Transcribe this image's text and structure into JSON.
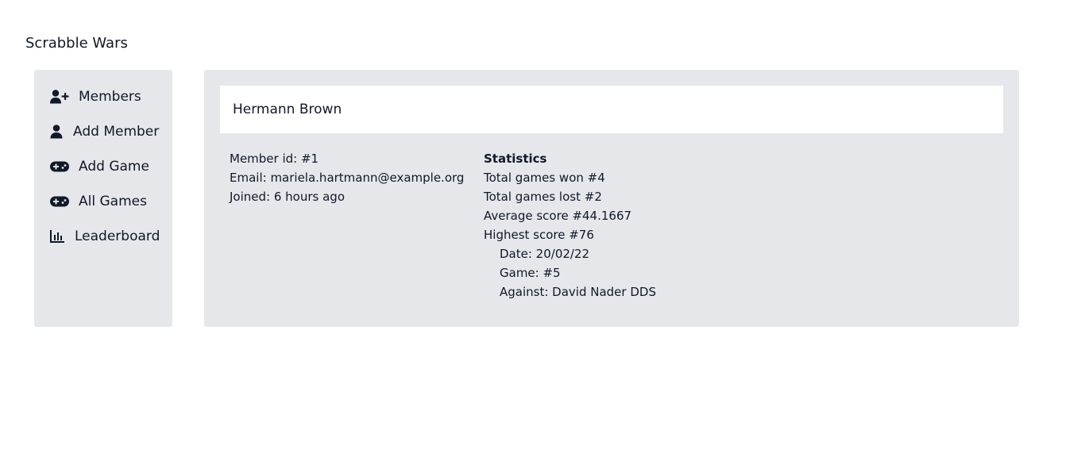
{
  "app": {
    "title": "Scrabble Wars"
  },
  "sidebar": {
    "items": [
      {
        "label": "Members",
        "icon": "user-plus-icon"
      },
      {
        "label": "Add Member",
        "icon": "user-icon"
      },
      {
        "label": "Add Game",
        "icon": "gamepad-icon"
      },
      {
        "label": "All Games",
        "icon": "gamepad-icon"
      },
      {
        "label": "Leaderboard",
        "icon": "bar-chart-icon"
      }
    ]
  },
  "member": {
    "name": "Hermann Brown",
    "id_line": "Member id: #1",
    "email_line": "Email: mariela.hartmann@example.org",
    "joined_line": "Joined: 6 hours ago"
  },
  "statistics": {
    "heading": "Statistics",
    "games_won": "Total games won #4",
    "games_lost": "Total games lost #2",
    "average_score": "Average score #44.1667",
    "highest_score": "Highest score #76",
    "highest_date": "Date: 20/02/22",
    "highest_game": "Game: #5",
    "highest_against": "Against: David Nader DDS"
  }
}
